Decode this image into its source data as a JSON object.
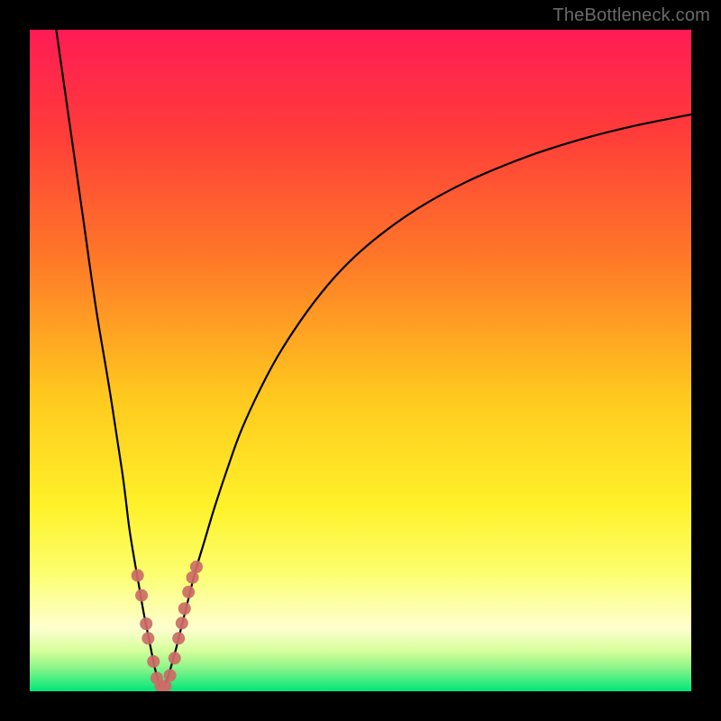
{
  "watermark": "TheBottleneck.com",
  "colors": {
    "frame": "#000000",
    "curve_stroke": "#000000",
    "marker_fill": "#cc6b66",
    "gradient_stops": [
      {
        "offset": 0.0,
        "color": "#ff1c55"
      },
      {
        "offset": 0.15,
        "color": "#ff3b3b"
      },
      {
        "offset": 0.35,
        "color": "#ff7a28"
      },
      {
        "offset": 0.55,
        "color": "#ffc81f"
      },
      {
        "offset": 0.72,
        "color": "#fff22a"
      },
      {
        "offset": 0.82,
        "color": "#fcff6e"
      },
      {
        "offset": 0.905,
        "color": "#feffcf"
      },
      {
        "offset": 0.94,
        "color": "#d4ff9a"
      },
      {
        "offset": 0.965,
        "color": "#8af58a"
      },
      {
        "offset": 1.0,
        "color": "#00e779"
      }
    ]
  },
  "chart_data": {
    "type": "line",
    "title": "",
    "xlabel": "",
    "ylabel": "",
    "xlim": [
      0,
      100
    ],
    "ylim": [
      0,
      100
    ],
    "x": [
      0,
      2,
      4,
      6,
      8,
      10,
      12,
      14,
      15,
      16,
      17,
      18,
      19,
      20,
      21,
      22,
      23,
      24,
      25,
      26,
      28,
      30,
      32,
      34,
      36,
      38,
      40,
      44,
      48,
      52,
      56,
      60,
      65,
      70,
      75,
      80,
      85,
      90,
      95,
      100
    ],
    "series": [
      {
        "name": "left-branch",
        "x": [
          4.0,
          6.0,
          8.0,
          10.0,
          12.0,
          14.0,
          15.0,
          15.8,
          16.5,
          17.2,
          18.0,
          18.8,
          19.3,
          19.7
        ],
        "y": [
          100.0,
          86.0,
          72.0,
          58.0,
          46.0,
          33.0,
          25.0,
          20.0,
          16.0,
          12.0,
          8.0,
          4.0,
          2.0,
          0.5
        ]
      },
      {
        "name": "right-branch",
        "x": [
          20.3,
          21.0,
          22.0,
          23.0,
          24.0,
          25.0,
          26.5,
          28.0,
          30.0,
          32.0,
          35.0,
          38.0,
          42.0,
          46.0,
          50.0,
          55.0,
          60.0,
          66.0,
          72.0,
          78.0,
          85.0,
          92.0,
          100.0
        ],
        "y": [
          0.5,
          2.5,
          6.0,
          10.0,
          14.0,
          18.0,
          23.0,
          28.0,
          34.0,
          39.5,
          46.0,
          51.5,
          57.5,
          62.5,
          66.5,
          70.5,
          73.8,
          77.0,
          79.6,
          81.8,
          83.9,
          85.6,
          87.2
        ]
      }
    ],
    "markers": [
      {
        "x": 16.3,
        "y": 17.5
      },
      {
        "x": 16.9,
        "y": 14.5
      },
      {
        "x": 17.6,
        "y": 10.2
      },
      {
        "x": 17.9,
        "y": 8.0
      },
      {
        "x": 18.7,
        "y": 4.5
      },
      {
        "x": 19.2,
        "y": 2.0
      },
      {
        "x": 19.8,
        "y": 0.8
      },
      {
        "x": 20.5,
        "y": 0.8
      },
      {
        "x": 21.2,
        "y": 2.4
      },
      {
        "x": 21.9,
        "y": 5.0
      },
      {
        "x": 22.5,
        "y": 8.0
      },
      {
        "x": 23.0,
        "y": 10.3
      },
      {
        "x": 23.4,
        "y": 12.5
      },
      {
        "x": 24.0,
        "y": 15.0
      },
      {
        "x": 24.6,
        "y": 17.2
      },
      {
        "x": 25.2,
        "y": 18.8
      }
    ]
  }
}
